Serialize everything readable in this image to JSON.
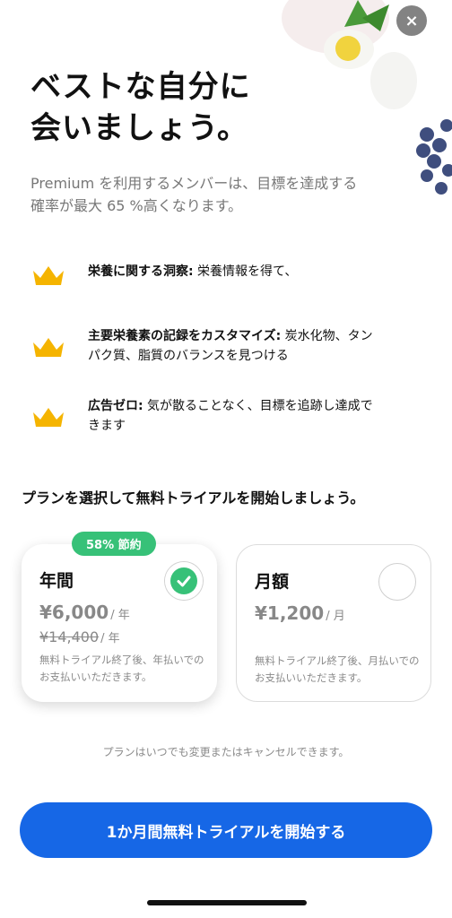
{
  "header": {
    "close_label": "×",
    "headline": "ベストな自分に\n会いましょう。",
    "subtext": "Premium を利用するメンバーは、目標を達成する確率が最大 65 %高くなります。"
  },
  "features": [
    {
      "icon": "crown-icon",
      "title": "栄養に関する洞察:",
      "desc": " 栄養情報を得て、"
    },
    {
      "icon": "crown-icon",
      "title": "主要栄養素の記録をカスタマイズ:",
      "desc": " 炭水化物、タンパク質、脂質のバランスを見つける"
    },
    {
      "icon": "crown-icon",
      "title": "広告ゼロ:",
      "desc": " 気が散ることなく、目標を追跡し達成できます"
    }
  ],
  "plans_section": {
    "title": "プランを選択して無料トライアルを開始しましょう。",
    "annual": {
      "badge": "58% 節約",
      "name": "年間",
      "price": "¥6,000",
      "unit": "/ 年",
      "old_price": "¥14,400",
      "old_unit": "/ 年",
      "note": "無料トライアル終了後、年払いでのお支払いいただきます。",
      "selected": true
    },
    "monthly": {
      "name": "月額",
      "price": "¥1,200",
      "unit": "/ 月",
      "note": "無料トライアル終了後、月払いでのお支払いいただきます。",
      "selected": false
    },
    "cancel_note": "プランはいつでも変更またはキャンセルできます。"
  },
  "cta": {
    "label": "1か月間無料トライアルを開始する"
  },
  "colors": {
    "accent_blue": "#1667e6",
    "badge_green": "#37c178",
    "crown_gold": "#f5b400"
  }
}
